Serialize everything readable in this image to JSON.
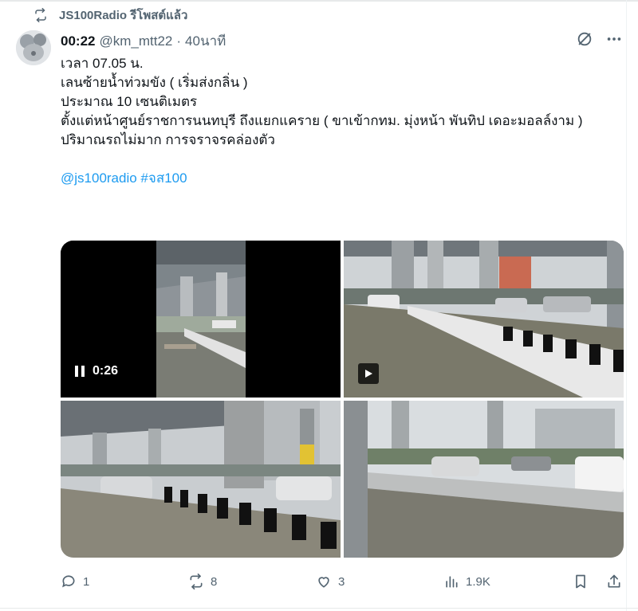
{
  "repost": {
    "label": "JS100Radio รีโพสต์แล้ว",
    "icon": "repost-icon"
  },
  "tweet": {
    "author_name": "00:22",
    "handle": "@km_mtt22",
    "separator": "·",
    "time": "40นาที",
    "lines": [
      "เวลา 07.05 น.",
      "เลนซ้ายน้ำท่วมขัง ( เริ่มส่งกลิ่น )",
      "ประมาณ 10 เซนติเมตร",
      "ตั้งแต่หน้าศูนย์ราชการนนทบุรี ถึงแยกแคราย ( ขาเข้ากทม. มุ่งหน้า พันทิป เดอะมอลล์งาม )",
      "ปริมาณรถไม่มาก การจราจรคล่องตัว"
    ],
    "tags": "@js100radio #จส100"
  },
  "media": {
    "video_time": "0:26",
    "items": [
      "video-flooded-road",
      "photo-flooded-lane-1",
      "photo-flooded-lane-2",
      "photo-flooded-lane-3"
    ]
  },
  "actions": {
    "replies": "1",
    "reposts": "8",
    "likes": "3",
    "views": "1.9K"
  },
  "colors": {
    "link": "#1d9bf0",
    "muted": "#536471",
    "text": "#0f1419"
  }
}
